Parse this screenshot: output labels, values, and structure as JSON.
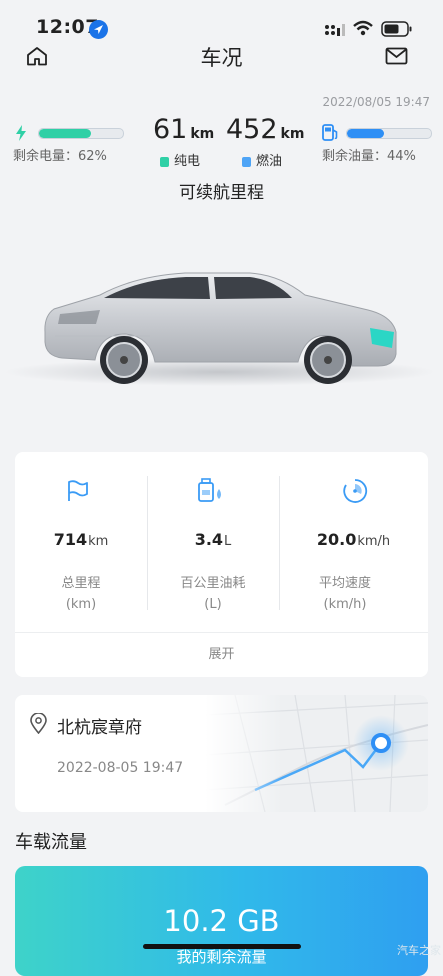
{
  "status": {
    "time": "12:07"
  },
  "header": {
    "title": "车况"
  },
  "updated": "2022/08/05 19:47",
  "battery": {
    "label": "剩余电量：62%",
    "level": 0.62,
    "color": "#2fd0a6"
  },
  "fuel": {
    "label": "剩余油量：44%",
    "level": 0.44,
    "color": "#2e8ff5"
  },
  "range": {
    "electric_value": "61",
    "electric_unit": "km",
    "electric_label": "纯电",
    "fuel_value": "452",
    "fuel_unit": "km",
    "fuel_label": "燃油",
    "caption": "可续航里程"
  },
  "stats": [
    {
      "value": "714",
      "unit": "km",
      "label": "总里程",
      "sub": "(km)",
      "icon": "flag-icon"
    },
    {
      "value": "3.4",
      "unit": "L",
      "label": "百公里油耗",
      "sub": "(L)",
      "icon": "fuel-can-icon"
    },
    {
      "value": "20.0",
      "unit": "km/h",
      "label": "平均速度",
      "sub": "(km/h)",
      "icon": "speedometer-icon"
    }
  ],
  "expand_label": "展开",
  "location": {
    "name": "北杭宸章府",
    "time": "2022-08-05 19:47"
  },
  "traffic": {
    "title": "车载流量",
    "value": "10.2 GB",
    "caption": "我的剩余流量"
  },
  "watermark": "汽车之家",
  "colors": {
    "accent": "#2e8ff5",
    "green": "#2fd0a6"
  }
}
